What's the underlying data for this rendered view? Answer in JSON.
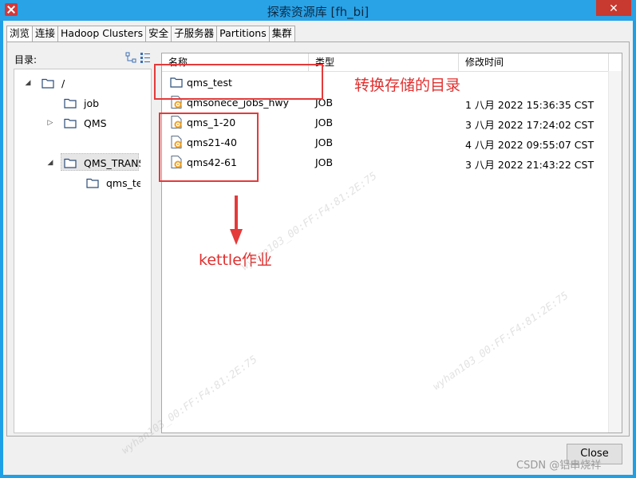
{
  "window": {
    "title": "探索资源库 [fh_bi]",
    "close_glyph": "✕"
  },
  "tabs": [
    {
      "label": "浏览",
      "active": true
    },
    {
      "label": "连接"
    },
    {
      "label": "Hadoop Clusters"
    },
    {
      "label": "安全"
    },
    {
      "label": "子服务器"
    },
    {
      "label": "Partitions"
    },
    {
      "label": "集群"
    }
  ],
  "left_panel": {
    "label": "目录:",
    "tree": [
      {
        "name": "/",
        "expander": "◢",
        "level": 0
      },
      {
        "name": "job",
        "expander": "",
        "level": 1
      },
      {
        "name": "QMS",
        "expander": "▷",
        "level": 1
      },
      {
        "name": "QMS_TRANS",
        "expander": "◢",
        "level": 1,
        "selected": true
      },
      {
        "name": "qms_te",
        "expander": "",
        "level": 2
      }
    ]
  },
  "file_list": {
    "columns": [
      "名称",
      "类型",
      "修改时间"
    ],
    "rows": [
      {
        "name": "qms_test",
        "type": "",
        "modified": "",
        "icon": "folder-icon"
      },
      {
        "name": "qmsonece_jobs_hwy",
        "type": "JOB",
        "modified": "1 八月 2022 15:36:35 CST",
        "icon": "job-icon"
      },
      {
        "name": "qms_1-20",
        "type": "JOB",
        "modified": "3 八月 2022 17:24:02 CST",
        "icon": "job-icon"
      },
      {
        "name": "qms21-40",
        "type": "JOB",
        "modified": "4 八月 2022 09:55:07 CST",
        "icon": "job-icon"
      },
      {
        "name": "qms42-61",
        "type": "JOB",
        "modified": "3 八月 2022 21:43:22 CST",
        "icon": "job-icon"
      }
    ]
  },
  "annotations": {
    "folder_note": "转换存储的目录",
    "job_note": "kettle作业",
    "color": "#e43a3a"
  },
  "footer": {
    "close_label": "Close",
    "csdn_credit": "CSDN @铝串烧祥"
  },
  "watermark_text": "wyhan103_00:FF:F4:81:2E:75"
}
